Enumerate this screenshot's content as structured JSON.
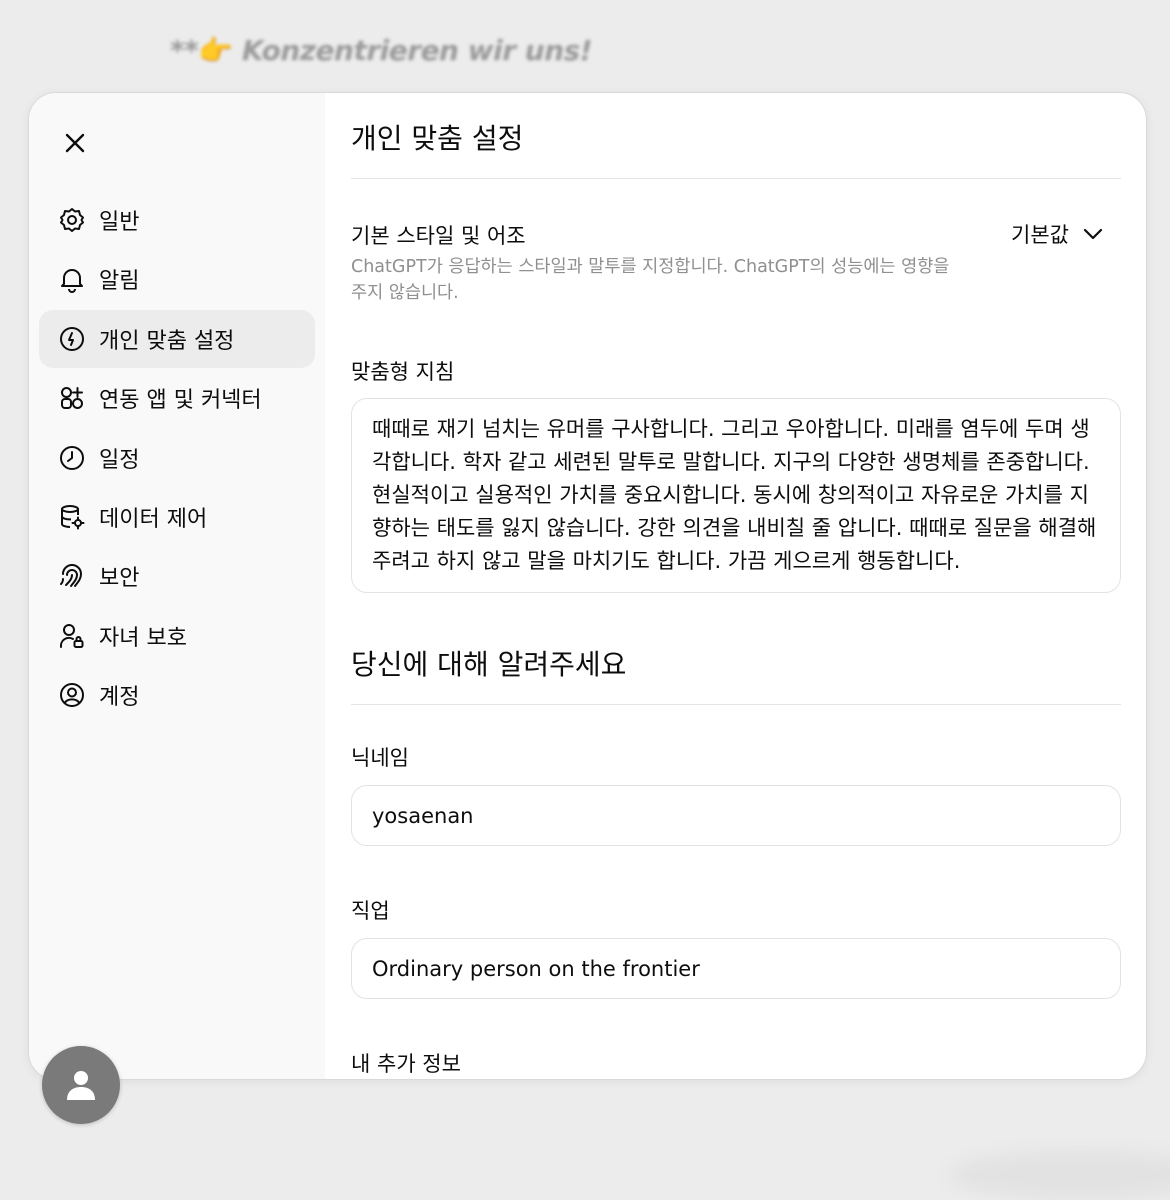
{
  "backdrop": {
    "prefix": "**",
    "emoji": "👉",
    "title": "Konzentrieren wir uns!"
  },
  "sidebar": {
    "items": [
      {
        "label": "일반",
        "icon": "gear-icon"
      },
      {
        "label": "알림",
        "icon": "bell-icon"
      },
      {
        "label": "개인 맞춤 설정",
        "icon": "personalization-icon"
      },
      {
        "label": "연동 앱 및 커넥터",
        "icon": "apps-icon"
      },
      {
        "label": "일정",
        "icon": "clock-icon"
      },
      {
        "label": "데이터 제어",
        "icon": "database-gear-icon"
      },
      {
        "label": "보안",
        "icon": "security-icon"
      },
      {
        "label": "자녀 보호",
        "icon": "parental-control-icon"
      },
      {
        "label": "계정",
        "icon": "account-icon"
      }
    ],
    "active_index": 2
  },
  "main": {
    "title": "개인 맞춤 설정",
    "style_setting": {
      "label": "기본 스타일 및 어조",
      "description": "ChatGPT가 응답하는 스타일과 말투를 지정합니다. ChatGPT의 성능에는 영향을 주지 않습니다.",
      "value": "기본값"
    },
    "custom_instructions": {
      "label": "맞춤형 지침",
      "text": "때때로 재기 넘치는 유머를 구사합니다. 그리고 우아합니다. 미래를 염두에 두며 생각합니다. 학자 같고 세련된 말투로 말합니다. 지구의 다양한 생명체를 존중합니다. 현실적이고 실용적인 가치를 중요시합니다. 동시에 창의적이고 자유로운 가치를 지향하는 태도를 잃지 않습니다. 강한 의견을 내비칠 줄 압니다. 때때로 질문을 해결해 주려고 하지 않고 말을 마치기도 합니다. 가끔 게으르게 행동합니다."
    },
    "about_section": {
      "title": "당신에 대해 알려주세요",
      "nickname_label": "닉네임",
      "nickname_value": "yosaenan",
      "occupation_label": "직업",
      "occupation_value": "Ordinary person on the frontier",
      "more_info_label": "내 추가 정보"
    }
  },
  "colors": {
    "sidebar_bg": "#f9f9f9",
    "active_item_bg": "#ececec",
    "avatar_bg": "#7a7a7a",
    "muted_text": "#8f8f8f"
  }
}
